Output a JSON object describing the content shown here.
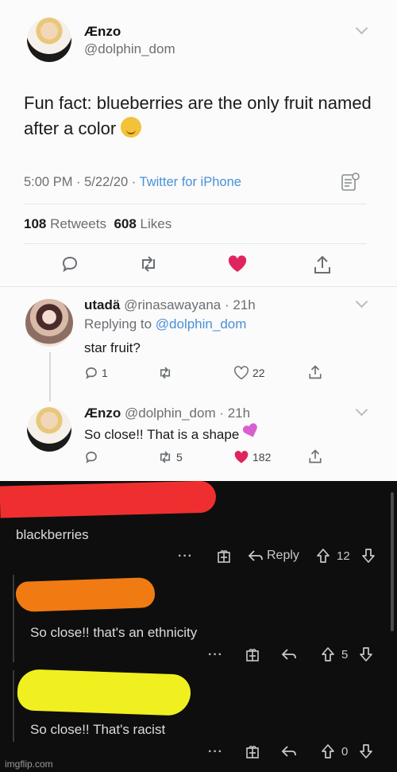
{
  "tweet": {
    "author_name": "Ænzo",
    "author_handle": "@dolphin_dom",
    "text": "Fun fact: blueberries are the only fruit named after a color",
    "time_date": "5:00 PM · 5/22/20 · ",
    "source": "Twitter for iPhone",
    "retweets_count": "108",
    "retweets_label": "Retweets",
    "likes_count": "608",
    "likes_label": "Likes"
  },
  "reply1": {
    "author_name": "utadä",
    "author_handle": "@rinasawayana",
    "age": " · 21h",
    "replying_prefix": "Replying to ",
    "replying_handle": "@dolphin_dom",
    "text": "star fruit?",
    "reply_count": "1",
    "like_count": "22"
  },
  "reply2": {
    "author_name": "Ænzo",
    "author_handle": "@dolphin_dom",
    "age": " · 21h",
    "text": "So close!! That is a shape",
    "retweet_count": "5",
    "like_count": "182"
  },
  "comments": [
    {
      "text": "blackberries",
      "reply_label": "Reply",
      "votes": "12",
      "redaction_color": "#ef2f2f"
    },
    {
      "text": "So close!! that's an ethnicity",
      "votes": "5",
      "redaction_color": "#f07b12"
    },
    {
      "text": "So close!! That's racist",
      "votes": "0",
      "redaction_color": "#f0f020"
    }
  ],
  "more_label": "···",
  "watermark": "imgflip.com",
  "colors": {
    "twitter_link": "#4a90d9",
    "like_heart": "#e0245e",
    "dark_bg": "#0e0e0e"
  }
}
